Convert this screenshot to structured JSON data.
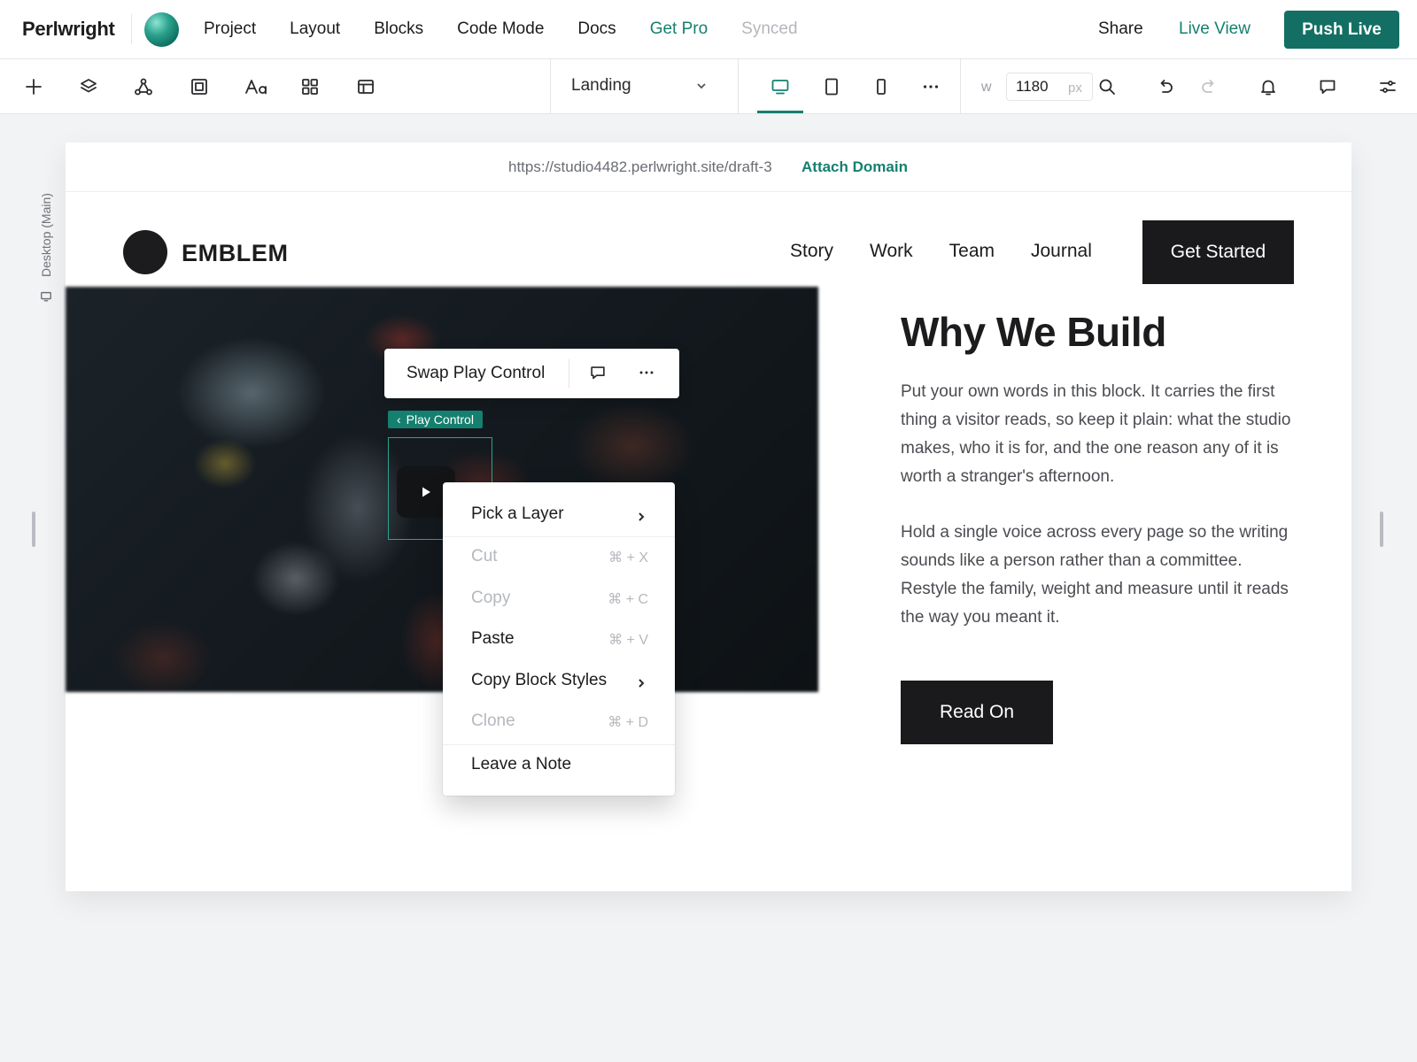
{
  "app": {
    "brand": "Perlwright",
    "nav": [
      "Project",
      "Layout",
      "Blocks",
      "Code Mode",
      "Docs"
    ],
    "get_pro": "Get Pro",
    "sync_status": "Synced",
    "share": "Share",
    "live_view": "Live View",
    "push_live": "Push Live",
    "accent_color": "#15806f"
  },
  "toolbar": {
    "tools": [
      "plus-icon",
      "layers-icon",
      "components-icon",
      "frame-icon",
      "typography-icon",
      "grid-icon",
      "layout-icon"
    ],
    "page": "Landing",
    "devices": [
      "desktop-icon",
      "tablet-icon",
      "mobile-icon",
      "more-icon"
    ],
    "active_device": "desktop",
    "width_label": "w",
    "width_value": "1180",
    "width_unit": "px"
  },
  "canvas": {
    "breakpoint_label": "Desktop (Main)",
    "url": "https://studio4482.perlwright.site/draft-3",
    "attach_domain": "Attach Domain"
  },
  "site": {
    "name": "EMBLEM",
    "nav": [
      "Story",
      "Work",
      "Team",
      "Journal"
    ],
    "cta": "Get Started",
    "heading": "Why We Build",
    "paragraph1": "Put your own words in this block. It carries the first thing a visitor reads, so keep it plain: what the studio makes, who it is for, and the one reason any of it is worth a stranger's afternoon.",
    "paragraph2": "Hold a single voice across every page so the writing sounds like a person rather than a committee. Restyle the family, weight and measure until it reads the way you meant it.",
    "button": "Read On"
  },
  "selection": {
    "toolbar_label": "Swap Play Control",
    "element_label": "Play Control"
  },
  "context_menu": {
    "items": [
      {
        "label": "Pick a Layer",
        "shortcut": "",
        "submenu": true,
        "disabled": false
      },
      {
        "label": "Cut",
        "shortcut": "⌘ + X",
        "submenu": false,
        "disabled": true
      },
      {
        "label": "Copy",
        "shortcut": "⌘ + C",
        "submenu": false,
        "disabled": true
      },
      {
        "label": "Paste",
        "shortcut": "⌘ + V",
        "submenu": false,
        "disabled": false
      },
      {
        "label": "Copy Block Styles",
        "shortcut": "",
        "submenu": true,
        "disabled": false
      },
      {
        "label": "Clone",
        "shortcut": "⌘ + D",
        "submenu": false,
        "disabled": true
      },
      {
        "label": "Leave a Note",
        "shortcut": "",
        "submenu": false,
        "disabled": false
      }
    ]
  }
}
